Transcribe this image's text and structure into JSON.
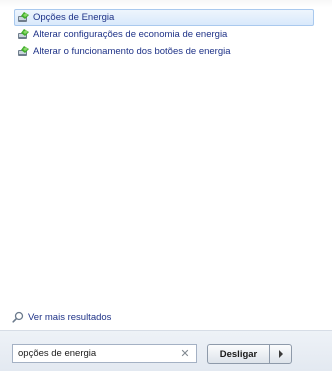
{
  "results": {
    "items": [
      {
        "label": "Opções de Energia",
        "icon": "power-options-icon",
        "selected": true
      },
      {
        "label": "Alterar configurações de economia de energia",
        "icon": "power-options-icon",
        "selected": false
      },
      {
        "label": "Alterar o funcionamento dos botões de energia",
        "icon": "power-options-icon",
        "selected": false
      }
    ]
  },
  "more_results": {
    "label": "Ver mais resultados",
    "icon": "search-icon"
  },
  "search": {
    "value": "opções de energia",
    "clear_icon": "close-icon"
  },
  "shutdown": {
    "label": "Desligar",
    "arrow_icon": "chevron-right-icon"
  },
  "colors": {
    "link_text": "#1e3287",
    "selection_border": "#a9c9ee",
    "selection_fill": "#d9e9fb",
    "bottom_bar": "#e3e9f1"
  }
}
